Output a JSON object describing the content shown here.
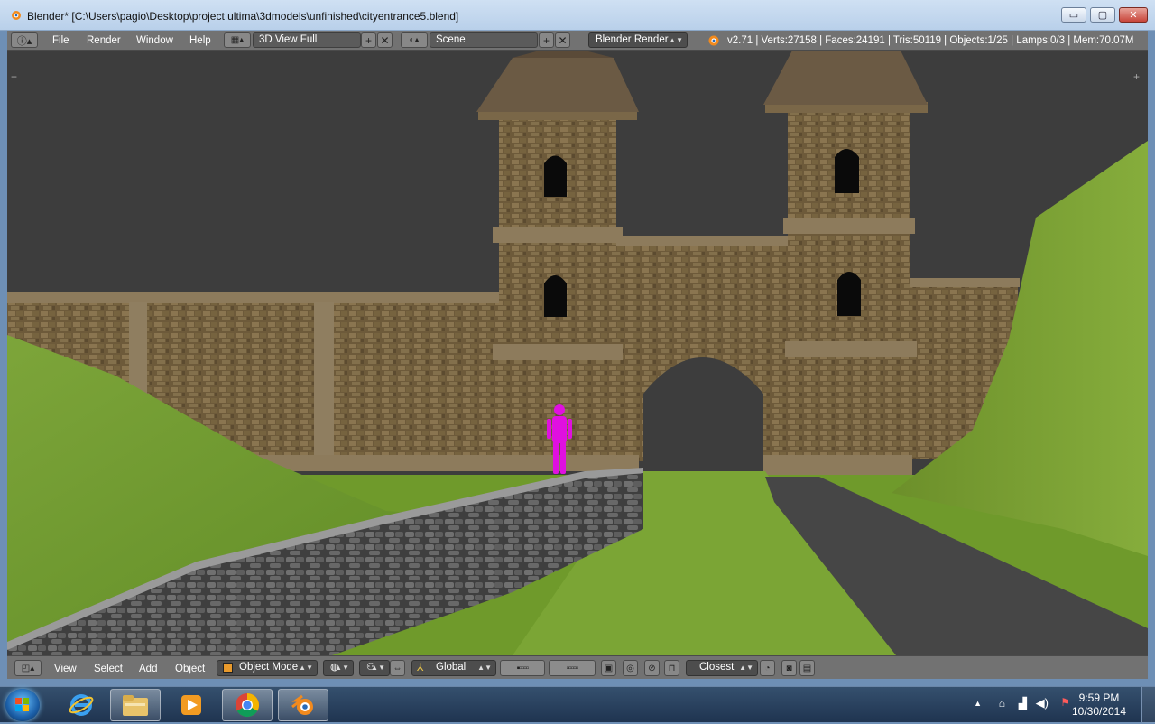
{
  "window": {
    "title": "Blender* [C:\\Users\\pagio\\Desktop\\project ultima\\3dmodels\\unfinished\\cityentrance5.blend]",
    "minimize_glyph": "▭",
    "maximize_glyph": "▢",
    "close_glyph": "✕"
  },
  "top_header": {
    "menus": [
      "File",
      "Render",
      "Window",
      "Help"
    ],
    "screen_layout": "3D View Full",
    "scene": "Scene",
    "render_engine": "Blender Render",
    "stats": "v2.71 | Verts:27158 | Faces:24191 | Tris:50119 | Objects:1/25 | Lamps:0/3 | Mem:70.07M"
  },
  "viewport_header": {
    "menus": [
      "View",
      "Select",
      "Add",
      "Object"
    ],
    "mode": "Object Mode",
    "orientation": "Global",
    "snap": "Closest"
  },
  "taskbar": {
    "time": "9:59 PM",
    "date": "10/30/2014"
  },
  "colors": {
    "blender_header": "#727272",
    "viewport_sky": "#3d3d3d",
    "grass": "#6f9a2b",
    "stone": "#7a6540",
    "figure": "#e010e0"
  }
}
